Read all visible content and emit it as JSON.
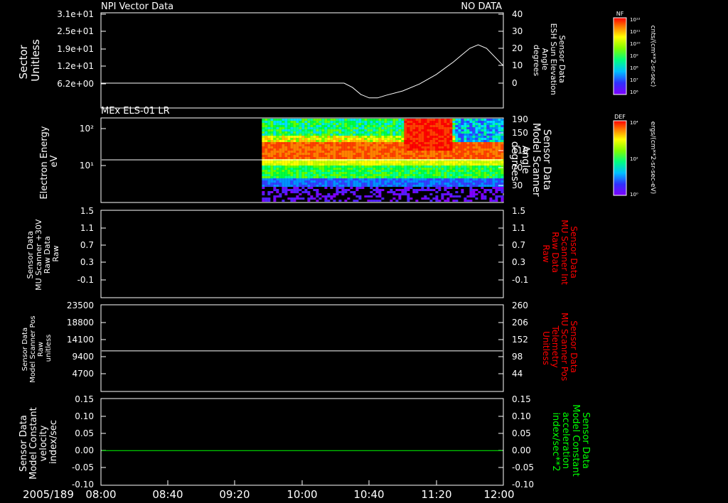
{
  "figure": {
    "date_label": "2005/189",
    "time_ticks": [
      "08:00",
      "08:40",
      "09:20",
      "10:00",
      "10:40",
      "11:20",
      "12:00"
    ]
  },
  "colors": {
    "background": "#000000",
    "axis": "#ffffff",
    "red_label": "#ff0000",
    "green_label": "#00ff00"
  },
  "chart_data": [
    {
      "type": "line",
      "panel_title": "NPI Vector Data",
      "status": "NO DATA",
      "ylabel_left": [
        "Sector",
        "Unitless"
      ],
      "yticks_left": [
        "3.1e+01",
        "2.5e+01",
        "1.9e+01",
        "1.2e+01",
        "6.2e+00"
      ],
      "ylabel_right": [
        "Sensor Data",
        "ESH Sun Elevation",
        "Angle",
        "degrees"
      ],
      "yticks_right": [
        "40",
        "30",
        "20",
        "10",
        "0"
      ],
      "ylim_right": [
        -10,
        40
      ],
      "series": [
        {
          "axis": "right",
          "color": "#ffffff",
          "x": [
            "08:00",
            "09:00",
            "10:00",
            "10:25",
            "10:30",
            "10:35",
            "10:40",
            "10:45",
            "10:50",
            "11:00",
            "11:10",
            "11:20",
            "11:30",
            "11:35",
            "11:40",
            "11:45",
            "11:50",
            "11:55",
            "12:00"
          ],
          "y": [
            0,
            0,
            0,
            0,
            -2.5,
            -6.5,
            -8.5,
            -8.5,
            -7,
            -4.5,
            -0.5,
            5,
            12,
            16,
            20,
            22,
            20,
            15,
            10
          ]
        }
      ]
    },
    {
      "type": "heatmap",
      "panel_title": "MEx ELS-01 LR",
      "ylabel_left": [
        "Electron Energy",
        "eV"
      ],
      "yticks_left": [
        "10²",
        "10¹"
      ],
      "ylabel_right": [
        "Sensor Data",
        "Model Scanner",
        "Angle",
        "degrees"
      ],
      "yticks_right": [
        "190",
        "150",
        "110",
        "70",
        "30"
      ],
      "ylim_right": [
        0,
        190
      ],
      "data_start": "09:36",
      "overlay_line": {
        "axis": "right",
        "color": "#ffffff",
        "y": 95
      },
      "colorbar": {
        "label": "DEF",
        "unit": "ergs/(cm**2-sr-sec-eV)",
        "tick_top": "10⁴",
        "tick_mid": "10²",
        "tick_bottom": "10⁰"
      }
    },
    {
      "type": "line",
      "ylabel_left": [
        "Sensor Data",
        "MU Scanner +30V",
        "Raw Data",
        "Raw"
      ],
      "yticks_left": [
        "1.5",
        "1.1",
        "0.7",
        "0.3",
        "-0.1"
      ],
      "ylabel_right": [
        "Sensor Data",
        "MU Scanner Int",
        "Raw Data",
        "Raw"
      ],
      "yticks_right": [
        "1.5",
        "1.1",
        "0.7",
        "0.3",
        "-0.1"
      ],
      "series": []
    },
    {
      "type": "line",
      "ylabel_left": [
        "Sensor Data",
        "Model Scanner Pos",
        "Raw",
        "unitless"
      ],
      "yticks_left": [
        "23500",
        "18800",
        "14100",
        "9400",
        "4700"
      ],
      "ylim_left": [
        0,
        23500
      ],
      "ylabel_right": [
        "Sensor Data",
        "MU Scanner Pos",
        "Telemetry",
        "Unitless"
      ],
      "yticks_right": [
        "260",
        "206",
        "152",
        "98",
        "44"
      ],
      "series": [
        {
          "axis": "left",
          "color": "#ffffff",
          "x": [
            "08:00",
            "12:00"
          ],
          "y": [
            11000,
            11000
          ]
        }
      ]
    },
    {
      "type": "line",
      "ylabel_left": [
        "Sensor Data",
        "Model Constant",
        "velocity",
        "index/sec"
      ],
      "yticks_left": [
        "0.15",
        "0.10",
        "0.05",
        "0.00",
        "-0.05",
        "-0.10"
      ],
      "ylim_left": [
        -0.1,
        0.15
      ],
      "ylabel_right": [
        "Sensor Data",
        "Model Constant",
        "acceleration",
        "index/sec**2"
      ],
      "yticks_right": [
        "0.15",
        "0.10",
        "0.05",
        "0.00",
        "-0.05",
        "-0.10"
      ],
      "series": [
        {
          "axis": "left",
          "color": "#00ff00",
          "x": [
            "08:00",
            "12:00"
          ],
          "y": [
            0,
            0
          ]
        }
      ]
    }
  ],
  "colorbars": [
    {
      "label": "NF",
      "unit": "cnts/(cm**2-sr-sec)",
      "ticks": [
        "10¹²",
        "10¹¹",
        "10¹⁰",
        "10⁹",
        "10⁸",
        "10⁷",
        "10⁶"
      ]
    },
    {
      "label": "DEF",
      "unit": "ergs/(cm**2-sr-sec-eV)",
      "ticks": [
        "10⁴",
        "10²",
        "10⁰"
      ]
    }
  ]
}
